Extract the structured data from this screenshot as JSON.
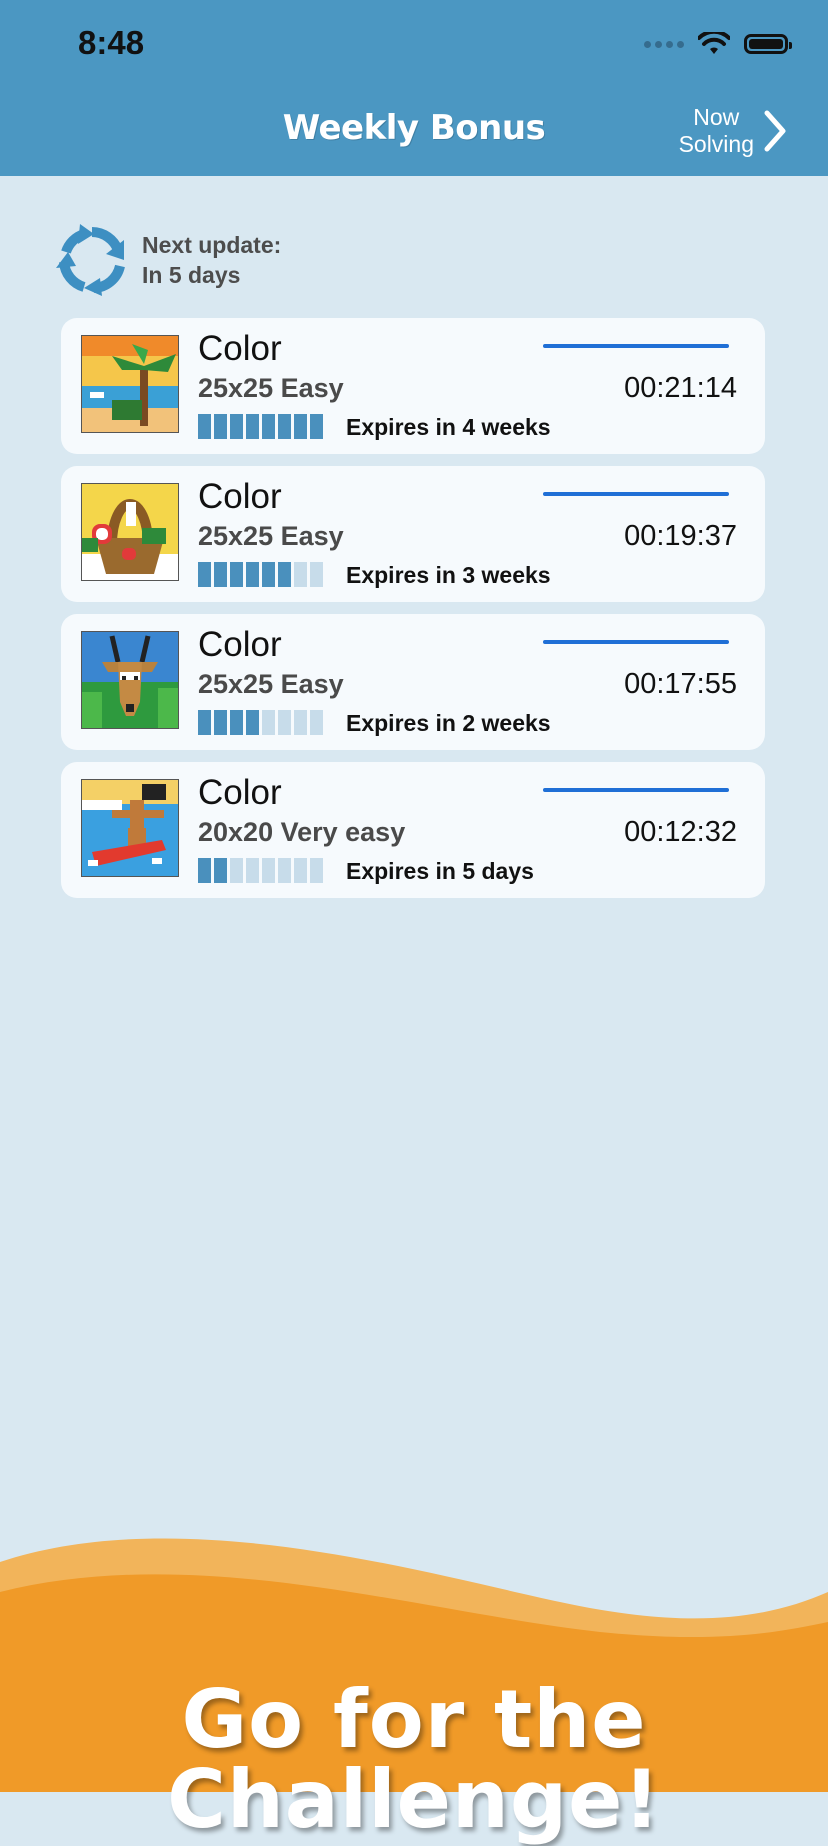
{
  "status_bar": {
    "time": "8:48"
  },
  "header": {
    "title": "Weekly Bonus",
    "now_solving": "Now\nSolving",
    "bg_color": "#4b97c2"
  },
  "update": {
    "label": "Next update:",
    "value": "In 5 days",
    "icon": "refresh-icon"
  },
  "puzzles": [
    {
      "title": "Color",
      "size": "25x25 Easy",
      "time": "00:21:14",
      "expires": "Expires in 4 weeks",
      "filled_segments": 8,
      "total_segments": 8
    },
    {
      "title": "Color",
      "size": "25x25 Easy",
      "time": "00:19:37",
      "expires": "Expires in 3 weeks",
      "filled_segments": 6,
      "total_segments": 8
    },
    {
      "title": "Color",
      "size": "25x25 Easy",
      "time": "00:17:55",
      "expires": "Expires in 2 weeks",
      "filled_segments": 4,
      "total_segments": 8
    },
    {
      "title": "Color",
      "size": "20x20 Very easy",
      "time": "00:12:32",
      "expires": "Expires in 5 days",
      "filled_segments": 2,
      "total_segments": 8
    }
  ],
  "banner": {
    "text": "Go for the Challenge!",
    "color": "#f09a28"
  }
}
